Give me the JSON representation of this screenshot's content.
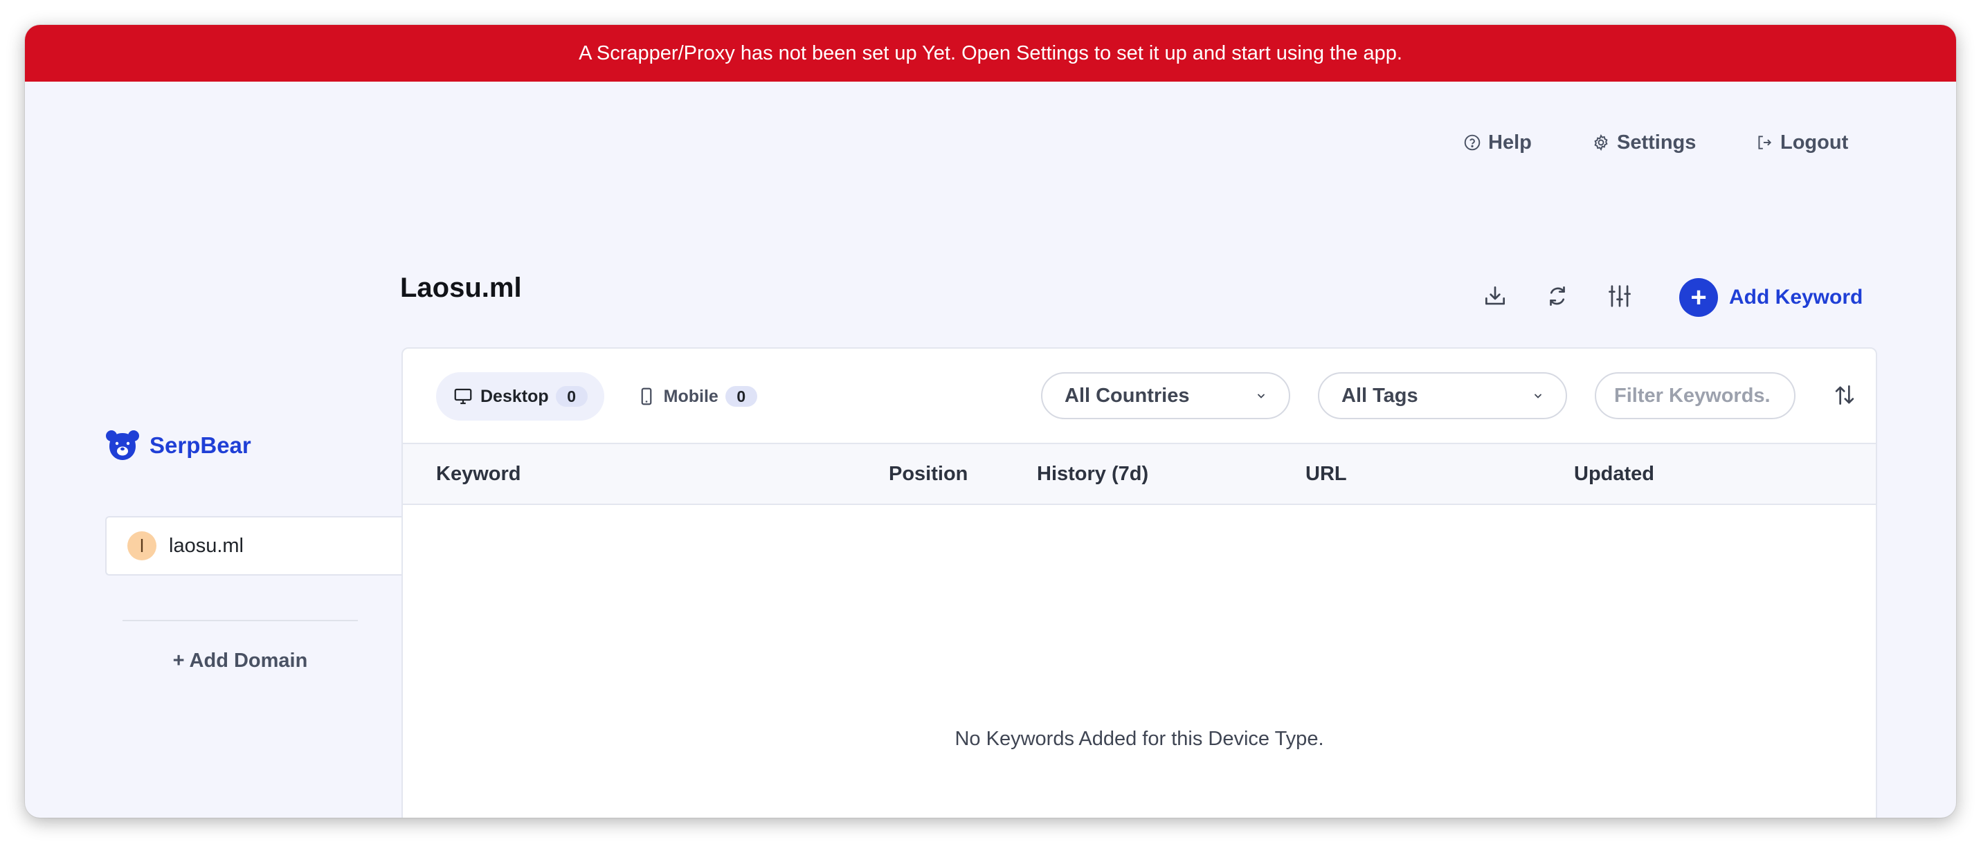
{
  "banner": {
    "message": "A Scrapper/Proxy has not been set up Yet. Open Settings to set it up and start using the app.",
    "color": "#d30d20"
  },
  "topnav": {
    "help": {
      "label": "Help",
      "icon": "help-circle-icon"
    },
    "settings": {
      "label": "Settings",
      "icon": "gear-icon"
    },
    "logout": {
      "label": "Logout",
      "icon": "logout-icon"
    }
  },
  "sidebar": {
    "logo_text": "SerpBear",
    "domains": [
      {
        "initial": "l",
        "label": "laosu.ml"
      }
    ],
    "add_domain_label": "+ Add Domain"
  },
  "main": {
    "domain_title": "Laosu.ml",
    "toolbar": {
      "icons": [
        "download-icon",
        "refresh-icon",
        "sliders-icon"
      ],
      "add_keyword_label": "Add Keyword",
      "add_keyword_symbol": "+"
    },
    "device_tabs": [
      {
        "label": "Desktop",
        "count": "0",
        "active": true,
        "icon": "desktop-icon"
      },
      {
        "label": "Mobile",
        "count": "0",
        "active": false,
        "icon": "mobile-icon"
      }
    ],
    "filters": {
      "countries": "All Countries",
      "tags": "All Tags",
      "search_placeholder": "Filter Keywords."
    },
    "table": {
      "columns": [
        "Keyword",
        "Position",
        "History (7d)",
        "URL",
        "Updated"
      ],
      "rows": [],
      "empty_message": "No Keywords Added for this Device Type."
    }
  },
  "colors": {
    "accent": "#1f3fd6",
    "background": "#f4f5fd",
    "avatar": "#fbd1a2"
  }
}
